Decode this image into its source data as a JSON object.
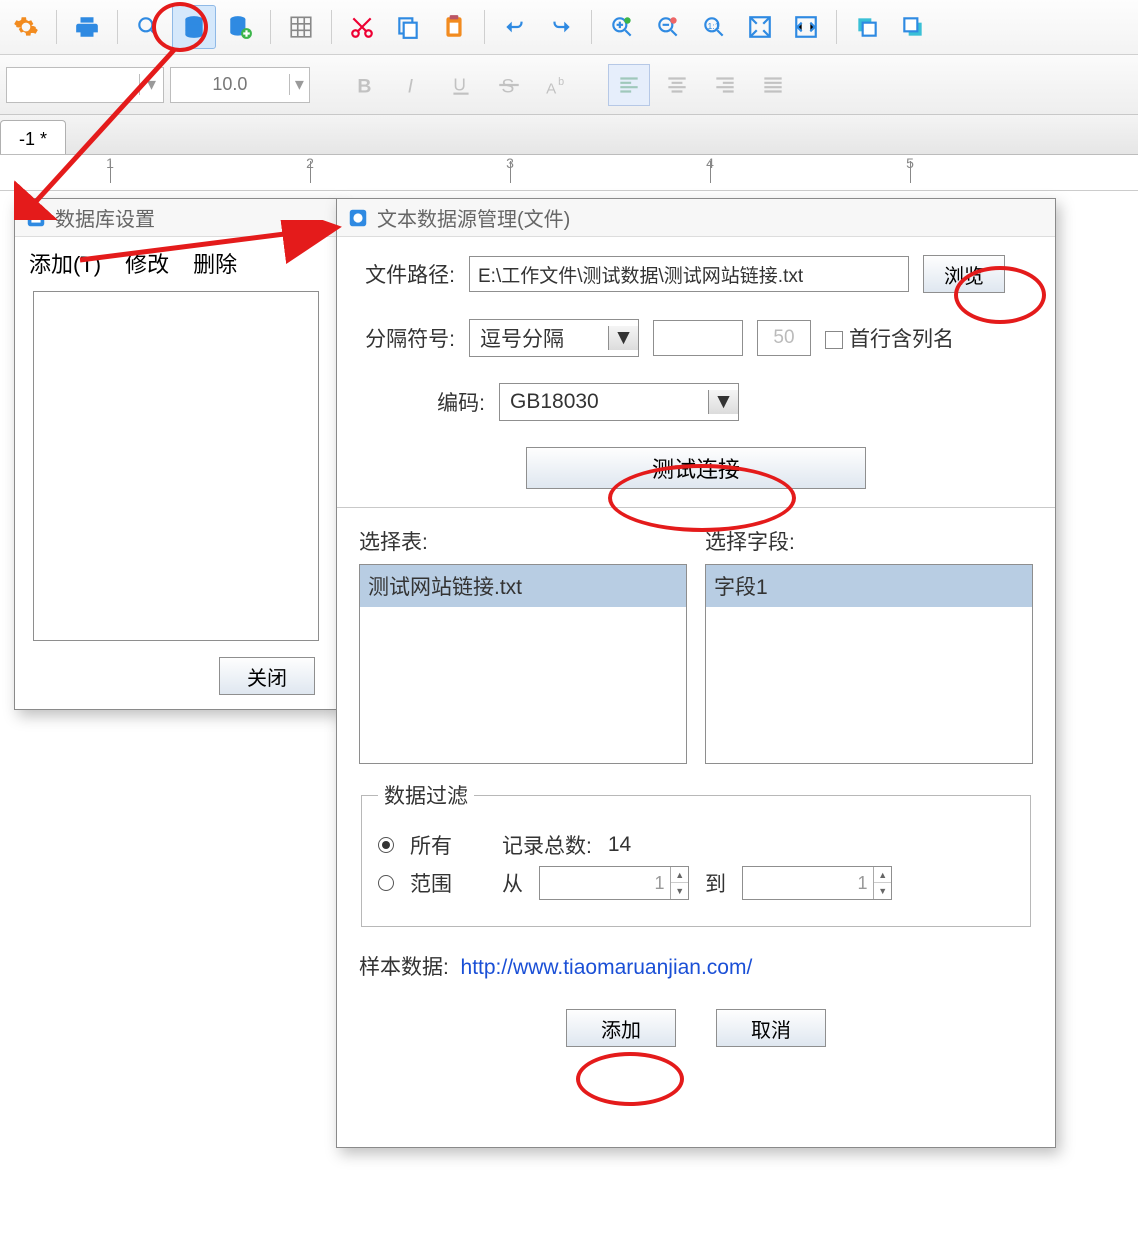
{
  "toolbar2": {
    "font_size": "10.0"
  },
  "document_tab": "-1 *",
  "ruler_labels": [
    "1",
    "2",
    "3",
    "4",
    "5"
  ],
  "dlg_db": {
    "title": "数据库设置",
    "menu": {
      "add": "添加(T)",
      "edit": "修改",
      "delete": "删除"
    },
    "close": "关闭"
  },
  "dlg_ds": {
    "title": "文本数据源管理(文件)",
    "labels": {
      "file_path": "文件路径:",
      "delimiter": "分隔符号:",
      "encoding": "编码:",
      "select_table": "选择表:",
      "select_field": "选择字段:",
      "filter_legend": "数据过滤",
      "all": "所有",
      "range": "范围",
      "record_total": "记录总数:",
      "from": "从",
      "to": "到",
      "sample": "样本数据:",
      "first_row_header": "首行含列名",
      "browse": "浏览",
      "test_conn": "测试连接",
      "add": "添加",
      "cancel": "取消"
    },
    "values": {
      "file_path": "E:\\工作文件\\测试数据\\测试网站链接.txt",
      "delimiter": "逗号分隔",
      "delimiter_num": "50",
      "encoding": "GB18030",
      "table_selected": "测试网站链接.txt",
      "field_selected": "字段1",
      "record_total": "14",
      "range_from": "1",
      "range_to": "1",
      "sample_url": "http://www.tiaomaruanjian.com/"
    }
  }
}
